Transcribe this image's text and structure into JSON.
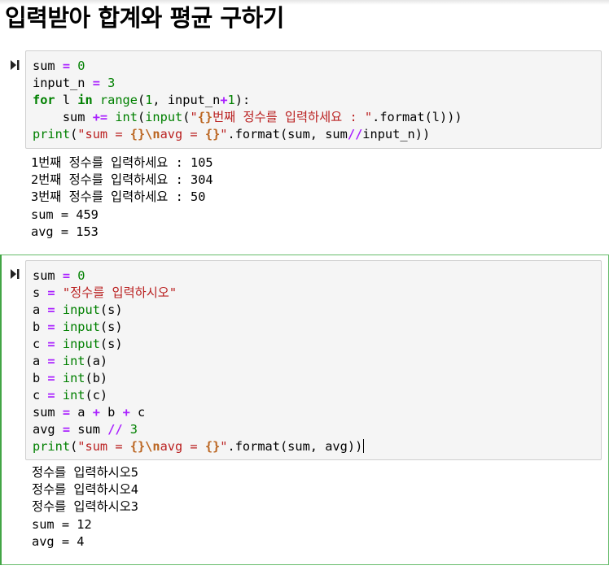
{
  "page": {
    "title": "입력받아 합계와 평균 구하기"
  },
  "cells": [
    {
      "run_icon": "run-cell-icon",
      "code_lines": [
        [
          [
            "n",
            "sum "
          ],
          [
            "o",
            "="
          ],
          [
            "n",
            " "
          ],
          [
            "num",
            "0"
          ]
        ],
        [
          [
            "n",
            "input_n "
          ],
          [
            "o",
            "="
          ],
          [
            "n",
            " "
          ],
          [
            "num",
            "3"
          ]
        ],
        [
          [
            "k",
            "for"
          ],
          [
            "n",
            " l "
          ],
          [
            "k",
            "in"
          ],
          [
            "n",
            " "
          ],
          [
            "b",
            "range"
          ],
          [
            "n",
            "("
          ],
          [
            "num",
            "1"
          ],
          [
            "n",
            ", input_n"
          ],
          [
            "o",
            "+"
          ],
          [
            "num",
            "1"
          ],
          [
            "n",
            "):"
          ]
        ],
        [
          [
            "n",
            "    sum "
          ],
          [
            "o",
            "+="
          ],
          [
            "n",
            " "
          ],
          [
            "b",
            "int"
          ],
          [
            "n",
            "("
          ],
          [
            "b",
            "input"
          ],
          [
            "n",
            "("
          ],
          [
            "s",
            "\""
          ],
          [
            "se",
            "{}"
          ],
          [
            "s",
            "번째 정수를 입력하세요 : \""
          ],
          [
            "n",
            ".format(l)))"
          ]
        ],
        [
          [
            "b",
            "print"
          ],
          [
            "n",
            "("
          ],
          [
            "s",
            "\"sum = "
          ],
          [
            "se",
            "{}"
          ],
          [
            "se",
            "\\n"
          ],
          [
            "s",
            "avg = "
          ],
          [
            "se",
            "{}"
          ],
          [
            "s",
            "\""
          ],
          [
            "n",
            ".format(sum, sum"
          ],
          [
            "o",
            "//"
          ],
          [
            "n",
            "input_n))"
          ]
        ]
      ],
      "output_lines": [
        "1번째 정수를 입력하세요 : 105",
        "2번째 정수를 입력하세요 : 304",
        "3번째 정수를 입력하세요 : 50",
        "sum = 459",
        "avg = 153"
      ]
    },
    {
      "run_icon": "run-cell-icon",
      "code_lines": [
        [
          [
            "n",
            "sum "
          ],
          [
            "o",
            "="
          ],
          [
            "n",
            " "
          ],
          [
            "num",
            "0"
          ]
        ],
        [
          [
            "n",
            "s "
          ],
          [
            "o",
            "="
          ],
          [
            "n",
            " "
          ],
          [
            "s",
            "\"정수를 입력하시오\""
          ]
        ],
        [
          [
            "n",
            "a "
          ],
          [
            "o",
            "="
          ],
          [
            "n",
            " "
          ],
          [
            "b",
            "input"
          ],
          [
            "n",
            "(s)"
          ]
        ],
        [
          [
            "n",
            "b "
          ],
          [
            "o",
            "="
          ],
          [
            "n",
            " "
          ],
          [
            "b",
            "input"
          ],
          [
            "n",
            "(s)"
          ]
        ],
        [
          [
            "n",
            "c "
          ],
          [
            "o",
            "="
          ],
          [
            "n",
            " "
          ],
          [
            "b",
            "input"
          ],
          [
            "n",
            "(s)"
          ]
        ],
        [
          [
            "n",
            "a "
          ],
          [
            "o",
            "="
          ],
          [
            "n",
            " "
          ],
          [
            "b",
            "int"
          ],
          [
            "n",
            "(a)"
          ]
        ],
        [
          [
            "n",
            "b "
          ],
          [
            "o",
            "="
          ],
          [
            "n",
            " "
          ],
          [
            "b",
            "int"
          ],
          [
            "n",
            "(b)"
          ]
        ],
        [
          [
            "n",
            "c "
          ],
          [
            "o",
            "="
          ],
          [
            "n",
            " "
          ],
          [
            "b",
            "int"
          ],
          [
            "n",
            "(c)"
          ]
        ],
        [
          [
            "n",
            "sum "
          ],
          [
            "o",
            "="
          ],
          [
            "n",
            " a "
          ],
          [
            "o",
            "+"
          ],
          [
            "n",
            " b "
          ],
          [
            "o",
            "+"
          ],
          [
            "n",
            " c"
          ]
        ],
        [
          [
            "n",
            "avg "
          ],
          [
            "o",
            "="
          ],
          [
            "n",
            " sum "
          ],
          [
            "o",
            "//"
          ],
          [
            "n",
            " "
          ],
          [
            "num",
            "3"
          ]
        ],
        [
          [
            "b",
            "print"
          ],
          [
            "n",
            "("
          ],
          [
            "s",
            "\"sum = "
          ],
          [
            "se",
            "{}"
          ],
          [
            "se",
            "\\n"
          ],
          [
            "s",
            "avg = "
          ],
          [
            "se",
            "{}"
          ],
          [
            "s",
            "\""
          ],
          [
            "n",
            ".format(sum, avg)"
          ],
          [
            "mb",
            ")"
          ]
        ]
      ],
      "output_lines": [
        "정수를 입력하시오5",
        "정수를 입력하시오4",
        "정수를 입력하시오3",
        "sum = 12",
        "avg = 4"
      ]
    }
  ]
}
